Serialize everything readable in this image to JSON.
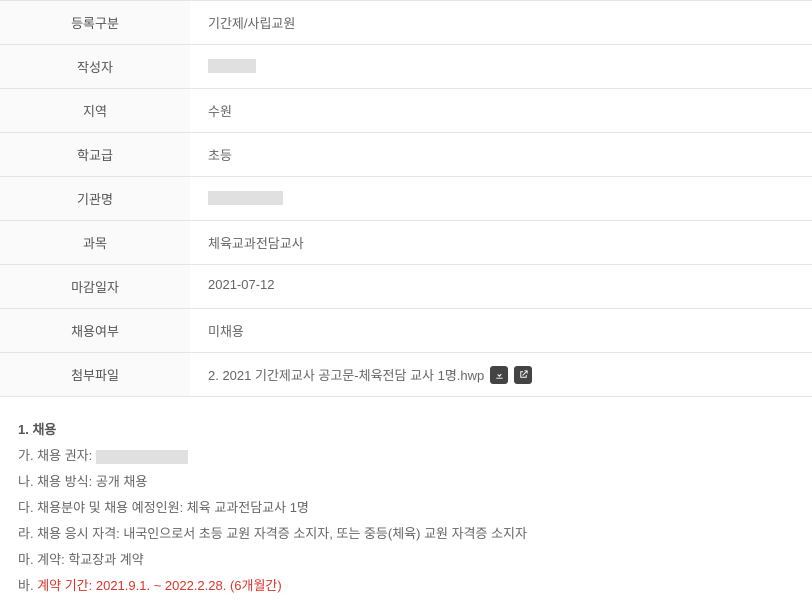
{
  "fields": {
    "reg_type": {
      "label": "등록구분",
      "value": "기간제/사립교원"
    },
    "author": {
      "label": "작성자"
    },
    "region": {
      "label": "지역",
      "value": "수원"
    },
    "school_level": {
      "label": "학교급",
      "value": "초등"
    },
    "inst_name": {
      "label": "기관명"
    },
    "subject": {
      "label": "과목",
      "value": "체육교과전담교사"
    },
    "deadline": {
      "label": "마감일자",
      "value": "2021-07-12"
    },
    "hire_status": {
      "label": "채용여부",
      "value": "미채용"
    },
    "attachment": {
      "label": "첨부파일",
      "filename": "2. 2021 기간제교사 공고문-체육전담 교사 1명.hwp"
    }
  },
  "content": {
    "heading": "1. 채용",
    "ga_prefix": "가. 채용 권자: ",
    "na": "나. 채용 방식: 공개 채용",
    "da": "다. 채용분야 및 채용 예정인원: 체육 교과전담교사 1명",
    "ra": "라. 채용 응시 자격: 내국인으로서 초등 교원 자격증 소지자, 또는 중등(체육) 교원 자격증 소지자",
    "ma": "마. 계약: 학교장과 계약",
    "ba_prefix": "바. ",
    "ba_label": "계약 기간",
    "ba_dates": ": 2021.9.1. ~ 2022.2.28. (6개월간)"
  }
}
